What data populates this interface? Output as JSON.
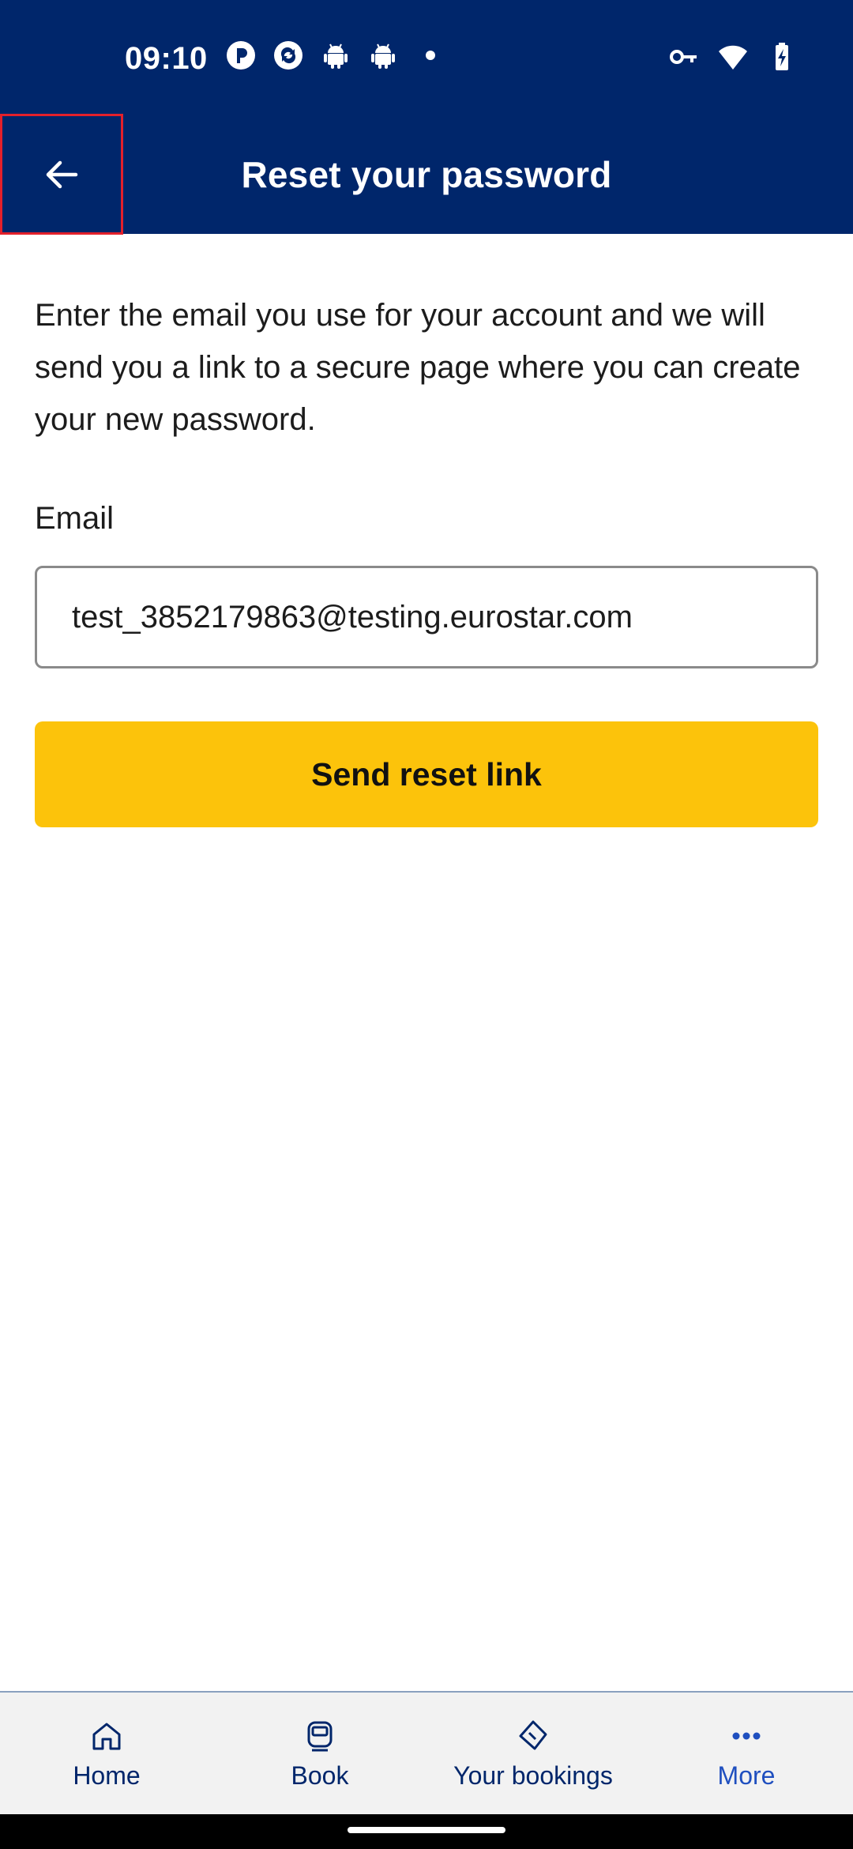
{
  "status_bar": {
    "time": "09:10",
    "left_icons": [
      "p-app-icon",
      "sync-app-icon",
      "android-icon",
      "android-icon",
      "dot-icon"
    ],
    "right_icons": [
      "vpn-key-icon",
      "wifi-icon",
      "battery-charging-icon"
    ]
  },
  "app_bar": {
    "title": "Reset your password",
    "back_icon": "arrow-left-icon"
  },
  "form": {
    "intro": "Enter the email you use for your account and we will send you a link to a secure page where you can create your new password.",
    "email_label": "Email",
    "email_value": "test_3852179863@testing.eurostar.com",
    "submit_label": "Send reset link"
  },
  "bottom_nav": {
    "items": [
      {
        "label": "Home",
        "icon": "home-icon"
      },
      {
        "label": "Book",
        "icon": "train-icon"
      },
      {
        "label": "Your bookings",
        "icon": "ticket-icon"
      },
      {
        "label": "More",
        "icon": "more-icon"
      }
    ]
  },
  "colors": {
    "brand_navy": "#00266b",
    "button_yellow": "#fcc30b",
    "active_nav": "#1f4fbf"
  }
}
